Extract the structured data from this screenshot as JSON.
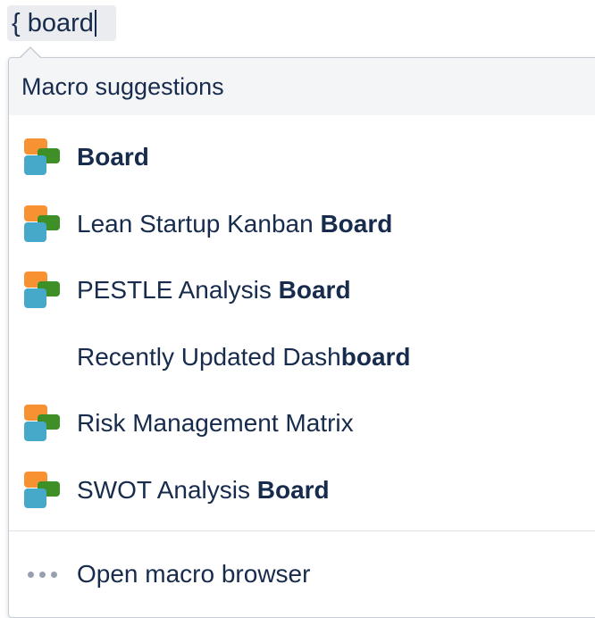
{
  "input": {
    "typed_text": "{ board"
  },
  "dropdown": {
    "header": "Macro suggestions",
    "items": [
      {
        "pre": "",
        "bold": "Board",
        "post": "",
        "icon": "board-macro-icon"
      },
      {
        "pre": "Lean Startup Kanban ",
        "bold": "Board",
        "post": "",
        "icon": "board-macro-icon"
      },
      {
        "pre": "PESTLE Analysis ",
        "bold": "Board",
        "post": "",
        "icon": "board-macro-icon"
      },
      {
        "pre": "Recently Updated Dash",
        "bold": "board",
        "post": "",
        "icon": ""
      },
      {
        "pre": "Risk Management Matrix",
        "bold": "",
        "post": "",
        "icon": "board-macro-icon"
      },
      {
        "pre": "SWOT Analysis ",
        "bold": "Board",
        "post": "",
        "icon": "board-macro-icon"
      }
    ],
    "footer_label": "Open macro browser"
  },
  "colors": {
    "icon_orange": "#f79232",
    "icon_green": "#3d8f26",
    "icon_blue": "#46a9c9",
    "text": "#172b4d",
    "header_bg": "#f4f5f7"
  }
}
